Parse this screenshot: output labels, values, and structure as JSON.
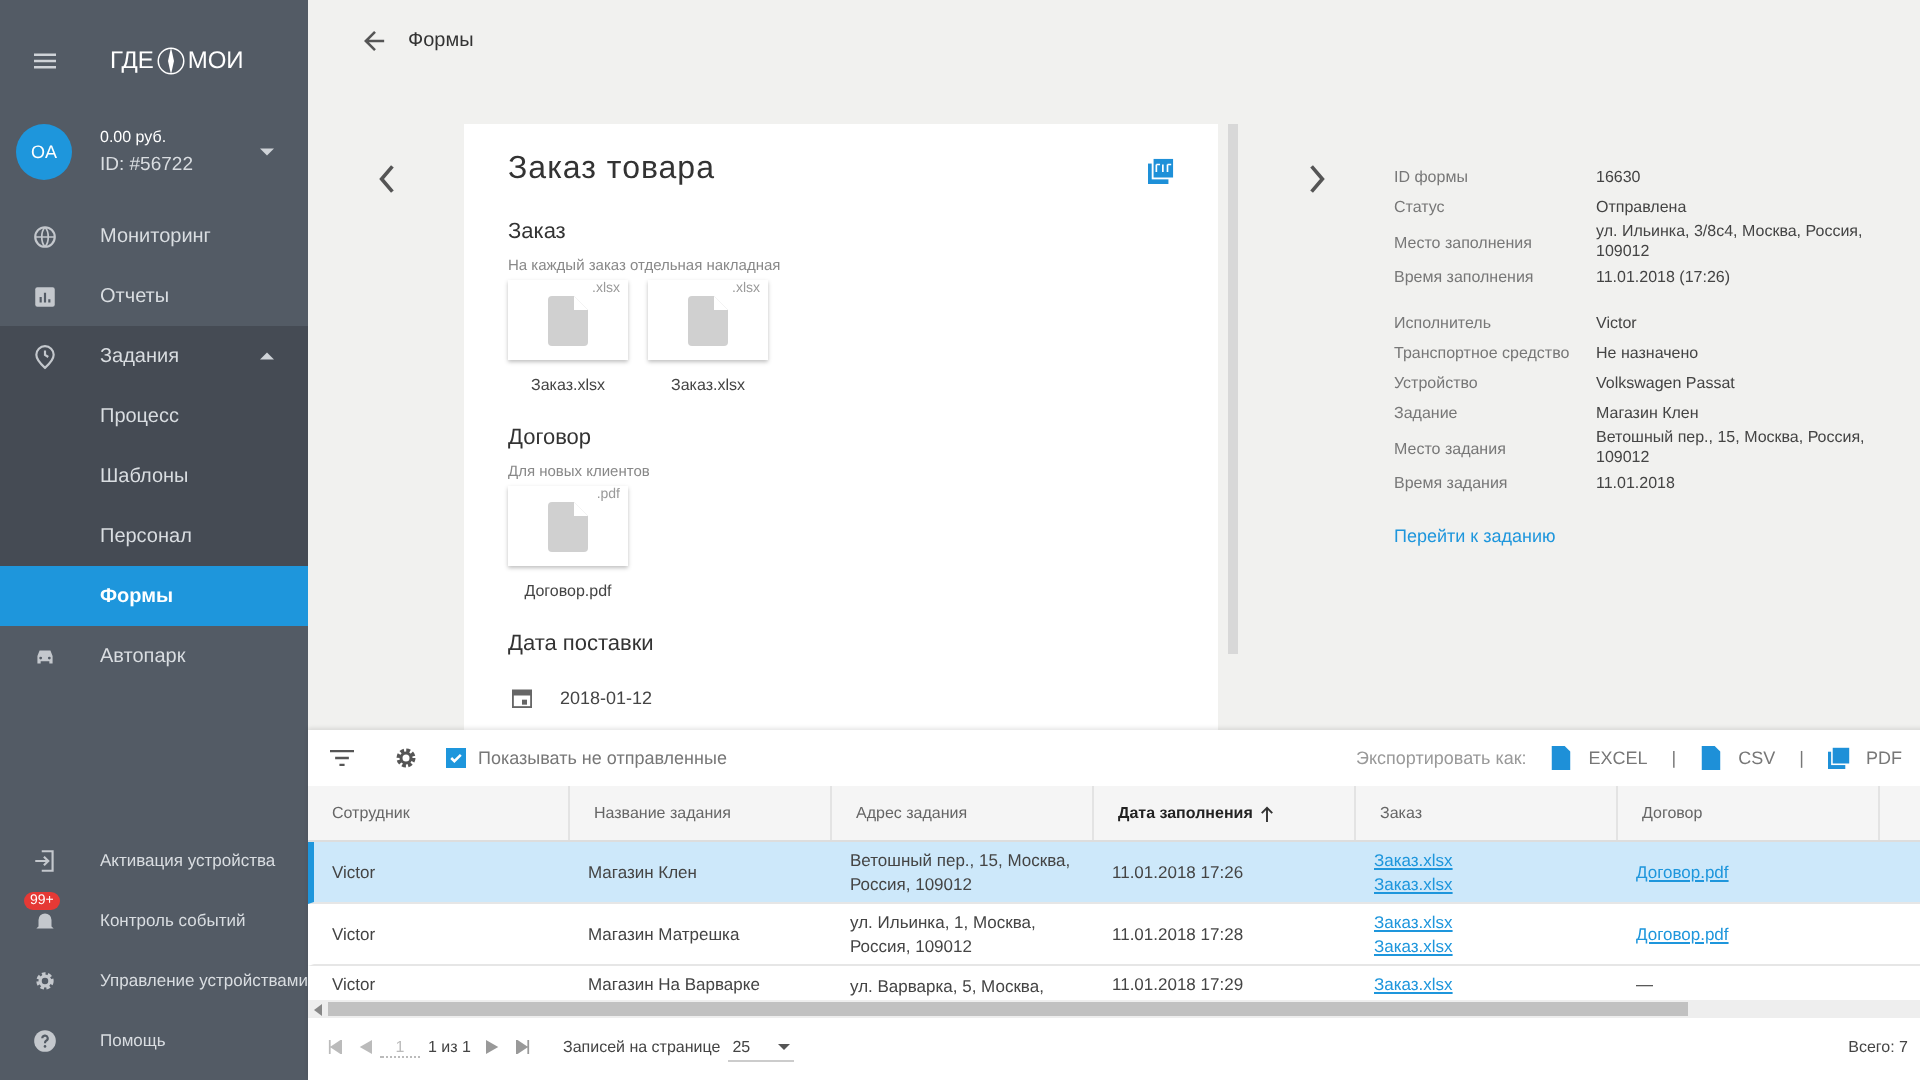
{
  "sidebar": {
    "logo": {
      "left": "ГДЕ",
      "right": "МОИ"
    },
    "account": {
      "avatar": "OA",
      "balance": "0.00 руб.",
      "id": "ID: #56722"
    },
    "items": [
      {
        "label": "Мониторинг",
        "selected": false
      },
      {
        "label": "Отчеты",
        "selected": false
      },
      {
        "label": "Задания",
        "selected": false,
        "expanded": true,
        "children": [
          {
            "label": "Процесс",
            "selected": false
          },
          {
            "label": "Шаблоны",
            "selected": false
          },
          {
            "label": "Персонал",
            "selected": false
          },
          {
            "label": "Формы",
            "selected": true
          }
        ]
      },
      {
        "label": "Автопарк",
        "selected": false
      }
    ],
    "bottom_items": [
      {
        "label": "Активация устройства"
      },
      {
        "label": "Контроль событий",
        "badge": "99+"
      },
      {
        "label": "Управление устройствами"
      },
      {
        "label": "Помощь"
      }
    ]
  },
  "header": {
    "title": "Формы"
  },
  "form_card": {
    "title": "Заказ товара",
    "sections": [
      {
        "kind": "files",
        "title": "Заказ",
        "hint": "На каждый заказ отдельная накладная",
        "files": [
          {
            "ext": ".xlsx",
            "name": "Заказ.xlsx"
          },
          {
            "ext": ".xlsx",
            "name": "Заказ.xlsx"
          }
        ]
      },
      {
        "kind": "files",
        "title": "Договор",
        "hint": "Для новых клиентов",
        "files": [
          {
            "ext": ".pdf",
            "name": "Договор.pdf"
          }
        ]
      },
      {
        "kind": "date",
        "title": "Дата поставки",
        "value": "2018-01-12"
      }
    ]
  },
  "details": {
    "groups": [
      [
        {
          "label": "ID формы",
          "value": "16630"
        },
        {
          "label": "Статус",
          "value": "Отправлена"
        },
        {
          "label": "Место заполнения",
          "value": "ул. Ильинка, 3/8с4, Москва, Россия, 109012"
        },
        {
          "label": "Время заполнения",
          "value": "11.01.2018 (17:26)"
        }
      ],
      [
        {
          "label": "Исполнитель",
          "value": "Victor"
        },
        {
          "label": "Транспортное средство",
          "value": "Не назначено"
        },
        {
          "label": "Устройство",
          "value": "Volkswagen Passat"
        },
        {
          "label": "Задание",
          "value": "Магазин Клен"
        },
        {
          "label": "Место задания",
          "value": "Ветошный пер., 15, Москва, Россия, 109012"
        },
        {
          "label": "Время задания",
          "value": "11.01.2018"
        }
      ]
    ],
    "link": "Перейти к заданию"
  },
  "toolbar": {
    "show_unsent": {
      "label": "Показывать не отправленные",
      "checked": true
    },
    "export_label": "Экспортировать как:",
    "formats": [
      {
        "label": "EXCEL"
      },
      {
        "label": "CSV"
      },
      {
        "label": "PDF"
      }
    ],
    "separator": "|"
  },
  "table": {
    "columns": [
      {
        "label": "Сотрудник",
        "sorted": false
      },
      {
        "label": "Название задания",
        "sorted": false
      },
      {
        "label": "Адрес задания",
        "sorted": false
      },
      {
        "label": "Дата заполнения",
        "sorted": true
      },
      {
        "label": "Заказ",
        "sorted": false
      },
      {
        "label": "Договор",
        "sorted": false
      }
    ],
    "rows": [
      {
        "selected": true,
        "employee": "Victor",
        "task": "Магазин Клен",
        "address": "Ветошный пер., 15, Москва, Россия, 109012",
        "date": "11.01.2018 17:26",
        "orders": [
          "Заказ.xlsx",
          "Заказ.xlsx"
        ],
        "contract": "Договор.pdf",
        "contract_link": true
      },
      {
        "selected": false,
        "employee": "Victor",
        "task": "Магазин Матрешка",
        "address": "ул. Ильинка, 1, Москва, Россия, 109012",
        "date": "11.01.2018 17:28",
        "orders": [
          "Заказ.xlsx",
          "Заказ.xlsx"
        ],
        "contract": "Договор.pdf",
        "contract_link": true
      },
      {
        "selected": false,
        "employee": "Victor",
        "task": "Магазин На Варварке",
        "address": "ул. Варварка, 5, Москва,",
        "date": "11.01.2018 17:29",
        "orders": [
          "Заказ.xlsx"
        ],
        "contract": "—",
        "contract_link": false
      }
    ]
  },
  "pagination": {
    "page": "1",
    "of": "1 из 1",
    "per_page_label": "Записей на странице",
    "per_page": "25",
    "total": "Всего: 7"
  }
}
